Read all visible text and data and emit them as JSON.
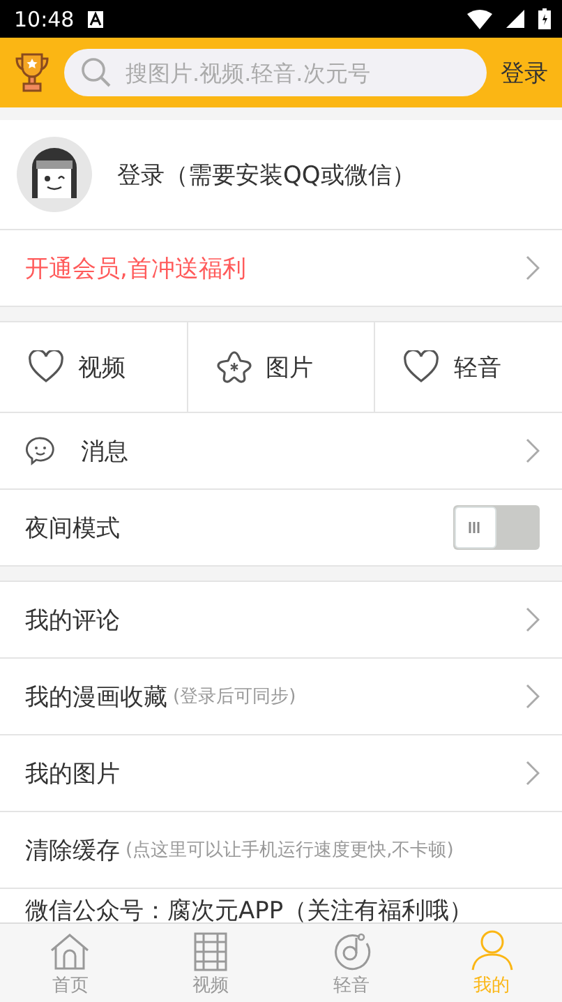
{
  "status_bar": {
    "time": "10:48"
  },
  "header": {
    "search": {
      "placeholder": "搜图片.视频.轻音.次元号"
    },
    "login_button": "登录"
  },
  "profile": {
    "label": "登录（需要安装QQ或微信）"
  },
  "promo": {
    "label": "开通会员,首冲送福利"
  },
  "favorites": [
    {
      "label": "视频",
      "kind": "heart"
    },
    {
      "label": "图片",
      "kind": "star"
    },
    {
      "label": "轻音",
      "kind": "heart"
    }
  ],
  "messages": {
    "label": "消息"
  },
  "night_mode": {
    "label": "夜间模式",
    "on": false
  },
  "menu": [
    {
      "label": "我的评论",
      "chevron": true
    },
    {
      "label": "我的漫画收藏",
      "note": "(登录后可同步)",
      "chevron": true
    },
    {
      "label": "我的图片",
      "chevron": true
    },
    {
      "label": "清除缓存",
      "note": "(点这里可以让手机运行速度更快,不卡顿)",
      "chevron": false
    },
    {
      "label": "微信公众号：腐次元APP（关注有福利哦）",
      "chevron": false
    }
  ],
  "bottom_nav": [
    {
      "label": "首页",
      "kind": "home",
      "selected": false
    },
    {
      "label": "视频",
      "kind": "film",
      "selected": false
    },
    {
      "label": "轻音",
      "kind": "music",
      "selected": false
    },
    {
      "label": "我的",
      "kind": "person",
      "selected": true
    }
  ]
}
